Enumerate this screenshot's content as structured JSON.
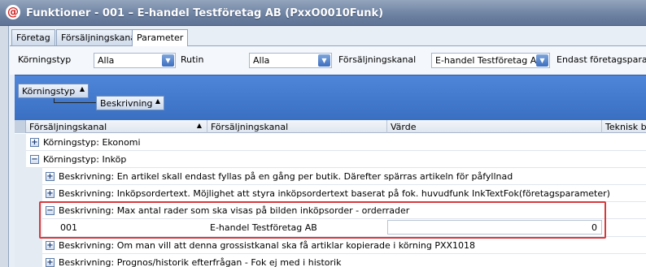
{
  "window": {
    "title": "Funktioner - 001 – E-handel Testföretag AB (PxxO0010Funk)",
    "icon": "app-logo-icon"
  },
  "tabs": [
    {
      "label": "Företag"
    },
    {
      "label": "Försäljningskanal"
    },
    {
      "label": "Parameter"
    }
  ],
  "filters": {
    "korningstyp_label": "Körningstyp",
    "korningstyp_value": "Alla",
    "rutin_label": "Rutin",
    "rutin_value": "Alla",
    "kanal_label": "Försäljningskanal",
    "kanal_value": "E-handel Testföretag AB",
    "endast_label": "Endast företagsparamet"
  },
  "group_panel": {
    "level1": "Körningstyp",
    "level2": "Beskrivning"
  },
  "grid": {
    "columns": [
      {
        "label": "Försäljningskanal"
      },
      {
        "label": "Försäljningskanal"
      },
      {
        "label": "Värde"
      },
      {
        "label": "Teknisk be"
      }
    ],
    "rows": {
      "g1": "Körningstyp: Ekonomi",
      "g2": "Körningstyp: Inköp",
      "b1": "Beskrivning: En artikel skall endast fyllas på en gång per butik. Därefter spärras artikeln för påfyllnad",
      "b2": "Beskrivning: Inköpsordertext. Möjlighet att styra inköpsordertext baserat på fok. huvudfunk InkTextFok(företagsparameter)",
      "b3": "Beskrivning: Max antal rader som ska visas på bilden inköpsorder - orderrader",
      "data_code": "001",
      "data_name": "E-handel Testföretag AB",
      "data_value": "0",
      "b4": "Beskrivning: Om man vill att denna grossistkanal ska få artiklar kopierade i körning PXX1018",
      "b5": "Beskrivning: Prognos/historik efterfrågan - Fok ej med i historik"
    }
  },
  "colors": {
    "title_bar": "#6f83a3",
    "group_bar": "#3a6fc2",
    "highlight": "#d9383a"
  }
}
